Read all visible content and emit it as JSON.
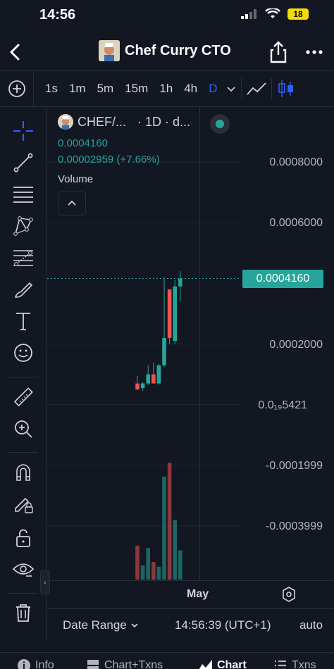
{
  "status": {
    "time": "14:56",
    "battery": "18"
  },
  "nav": {
    "title": "Chef Curry CTO"
  },
  "toolbar": {
    "intervals": [
      "1s",
      "1m",
      "5m",
      "15m",
      "1h",
      "4h",
      "D"
    ],
    "active_interval": "D"
  },
  "legend": {
    "symbol": "CHEF/...",
    "interval_info": "· 1D · d...",
    "price": "0.0004160",
    "change": "0.00002959 (+7.66%)",
    "volume_label": "Volume"
  },
  "price_axis": {
    "labels": [
      "0.0008000",
      "0.0006000",
      "0.0002000",
      "0.0₁₉5421",
      "-0.0001999",
      "-0.0003999"
    ],
    "current_price_tag": "0.0004160"
  },
  "time_axis": {
    "labels": [
      "May"
    ]
  },
  "bottom": {
    "date_range": "Date Range",
    "clock": "14:56:39 (UTC+1)",
    "scale": "auto"
  },
  "tabs": [
    {
      "label": "Info",
      "icon": "info-icon"
    },
    {
      "label": "Chart+Txns",
      "icon": "chart-txns-icon"
    },
    {
      "label": "Chart",
      "icon": "chart-icon",
      "active": true
    },
    {
      "label": "Txns",
      "icon": "list-icon"
    }
  ],
  "colors": {
    "up": "#26a69a",
    "down": "#ef5350",
    "accent": "#2962ff",
    "background": "#131722"
  },
  "chart_data": {
    "type": "candlestick",
    "price_scale": {
      "min": -0.0003999,
      "max": 0.0008
    },
    "candles": [
      {
        "open": 7e-05,
        "high": 9.5e-05,
        "low": 5e-05,
        "close": 5e-05,
        "dir": "down",
        "volume": 0.29
      },
      {
        "open": 5.5e-05,
        "high": 7.5e-05,
        "low": 4.5e-05,
        "close": 7e-05,
        "dir": "up",
        "volume": 0.12
      },
      {
        "open": 7e-05,
        "high": 0.00013,
        "low": 6.5e-05,
        "close": 0.0001,
        "dir": "up",
        "volume": 0.27
      },
      {
        "open": 0.0001,
        "high": 0.00014,
        "low": 9e-05,
        "close": 7e-05,
        "dir": "down",
        "volume": 0.15
      },
      {
        "open": 7e-05,
        "high": 0.000135,
        "low": 6.5e-05,
        "close": 0.00013,
        "dir": "up",
        "volume": 0.11
      },
      {
        "open": 0.00013,
        "high": 0.00042,
        "low": 0.000125,
        "close": 0.00022,
        "dir": "up",
        "volume": 0.88
      },
      {
        "open": 0.00022,
        "high": 0.00038,
        "low": 0.0002,
        "close": 0.00038,
        "dir": "down",
        "volume": 1.0
      },
      {
        "open": 0.00021,
        "high": 0.00041,
        "low": 0.0002,
        "close": 0.00039,
        "dir": "up",
        "volume": 0.51
      },
      {
        "open": 0.00039,
        "high": 0.00044,
        "low": 0.00034,
        "close": 0.000416,
        "dir": "up",
        "volume": 0.25
      }
    ]
  }
}
